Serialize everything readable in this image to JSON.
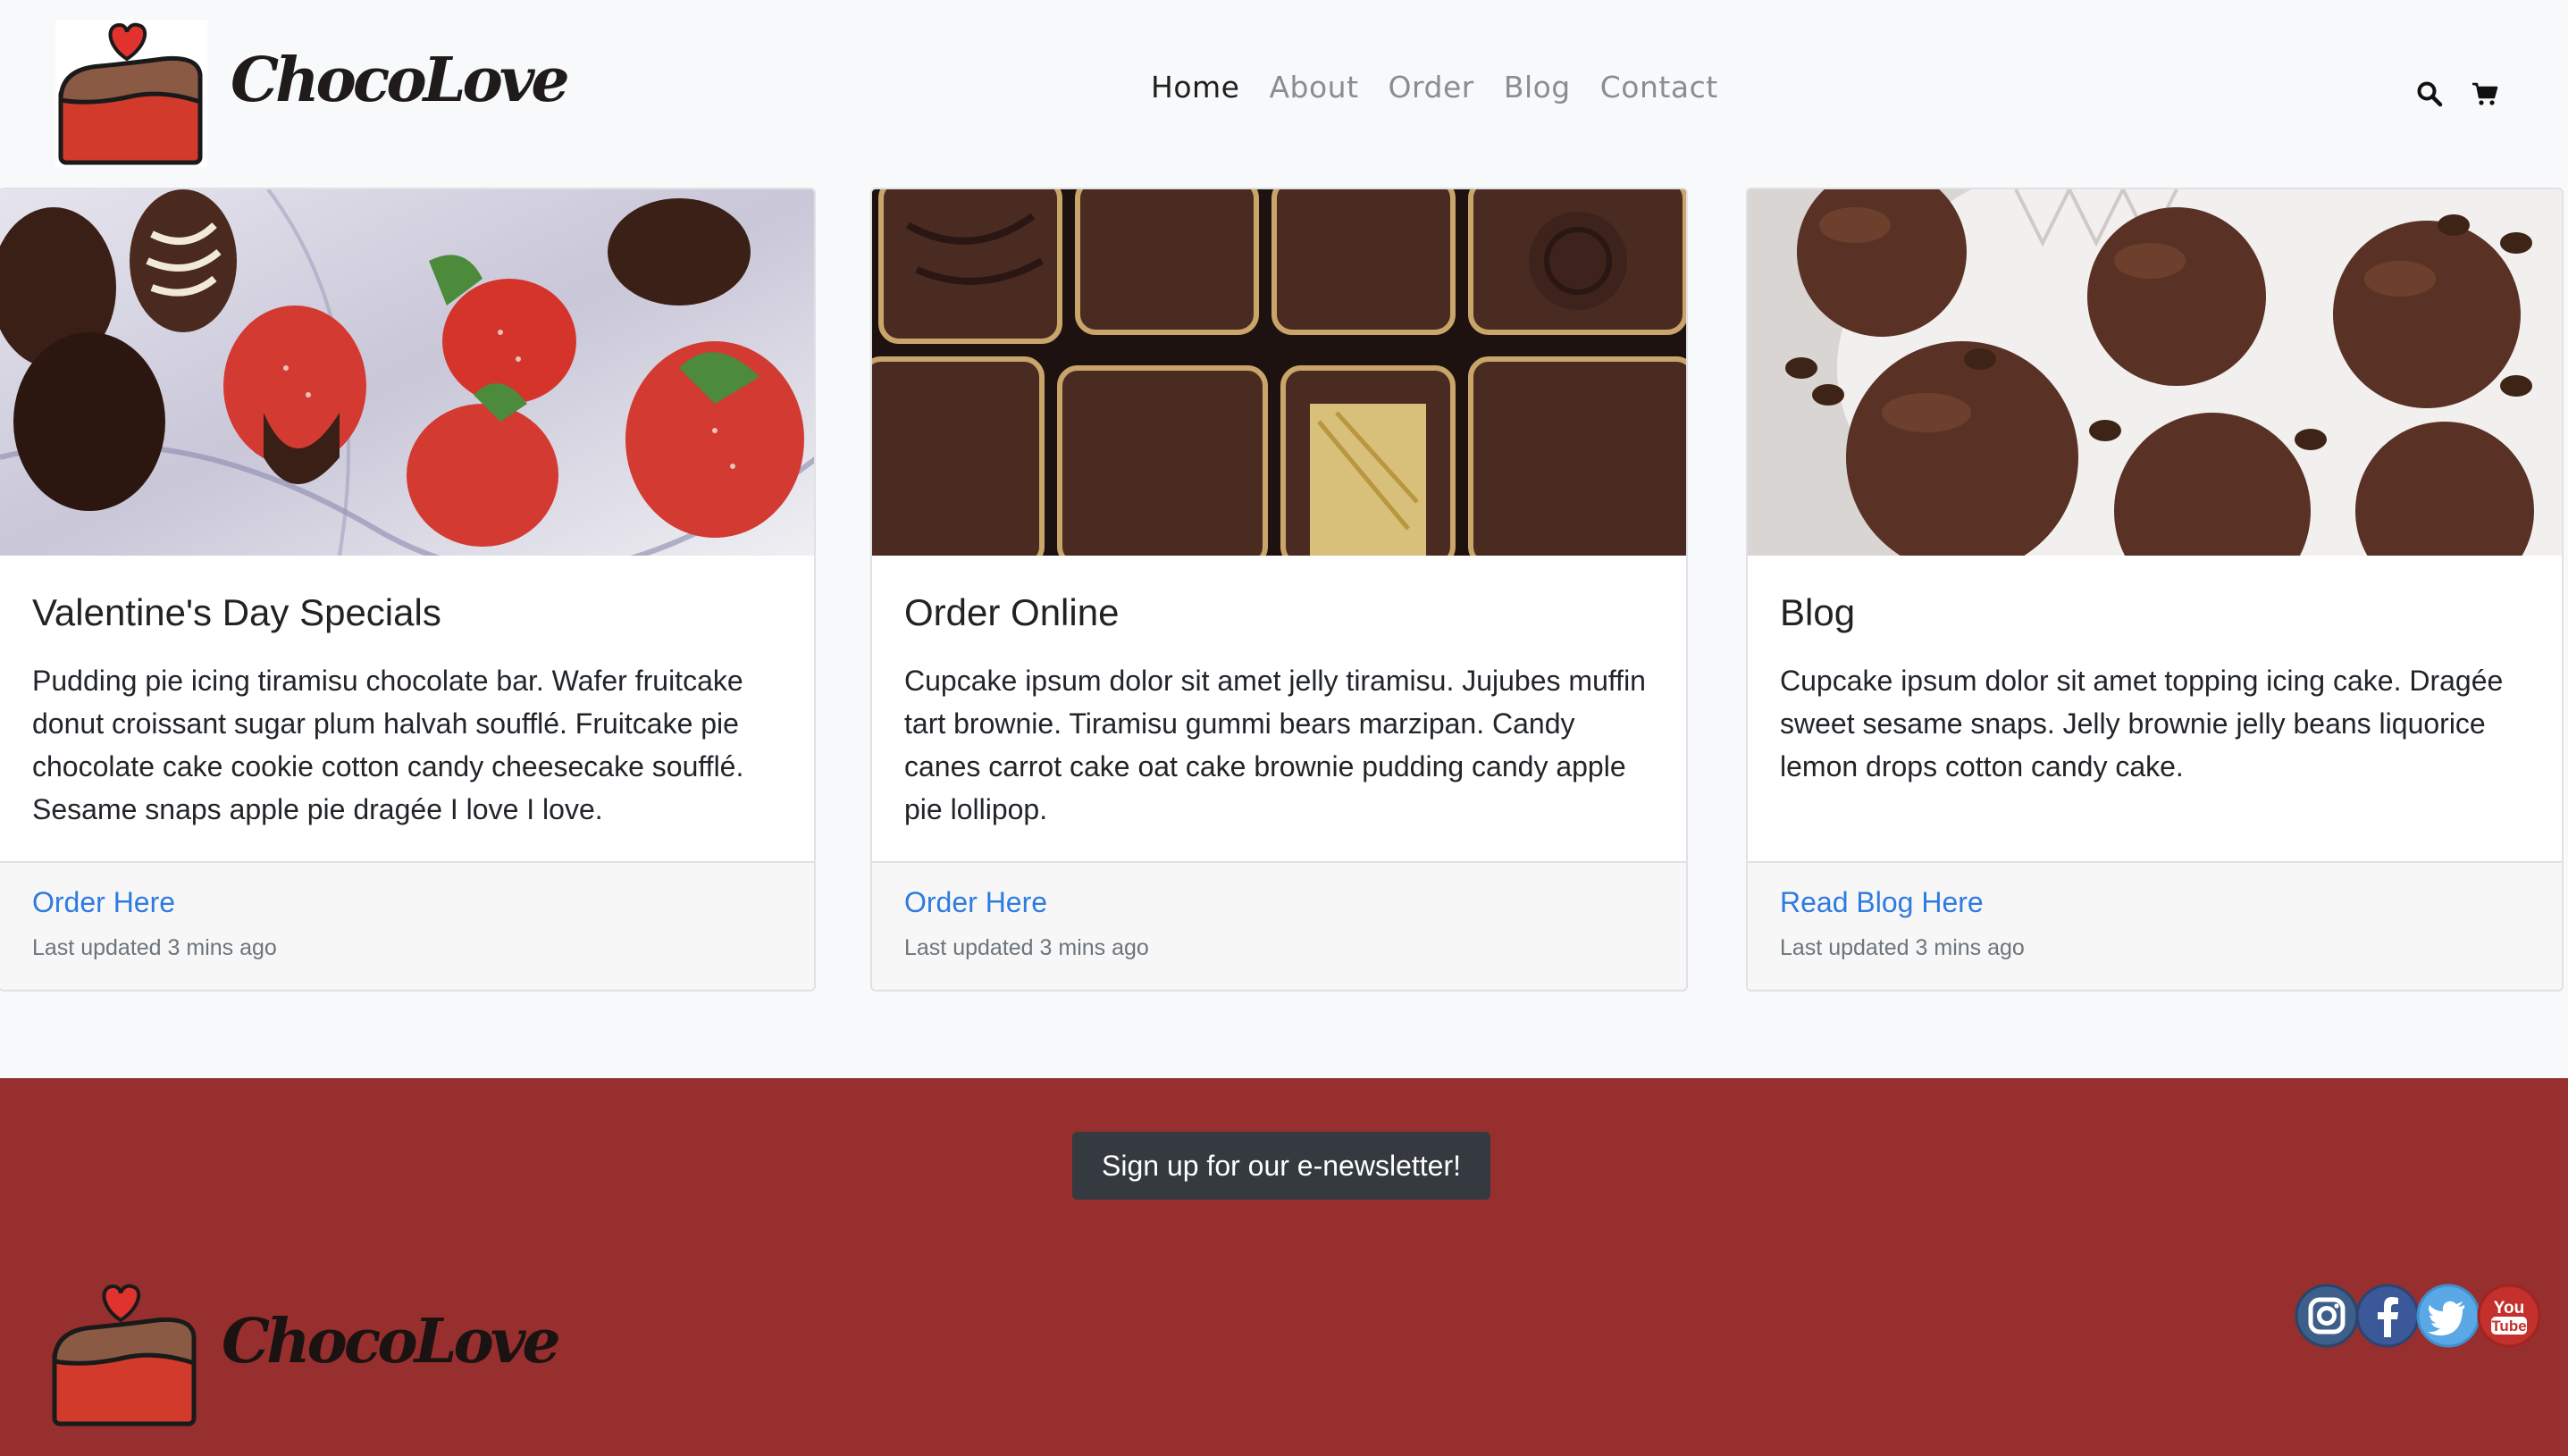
{
  "brand": {
    "name": "ChocoLove"
  },
  "nav": {
    "items": [
      {
        "label": "Home",
        "active": true
      },
      {
        "label": "About",
        "active": false
      },
      {
        "label": "Order",
        "active": false
      },
      {
        "label": "Blog",
        "active": false
      },
      {
        "label": "Contact",
        "active": false
      }
    ],
    "icons": [
      "search-icon",
      "cart-icon"
    ]
  },
  "cards": [
    {
      "image": "chocolate-covered-strawberries",
      "title": "Valentine's Day Specials",
      "text": "Pudding pie icing tiramisu chocolate bar. Wafer fruitcake donut croissant sugar plum halvah soufflé. Fruitcake pie chocolate cake cookie cotton candy cheesecake soufflé. Sesame snaps apple pie dragée I love I love.",
      "link": "Order Here",
      "updated": "Last updated 3 mins ago"
    },
    {
      "image": "box-of-chocolates",
      "title": "Order Online",
      "text": "Cupcake ipsum dolor sit amet jelly tiramisu. Jujubes muffin tart brownie. Tiramisu gummi bears marzipan. Candy canes carrot cake oat cake brownie pudding candy apple pie lollipop.",
      "link": "Order Here",
      "updated": "Last updated 3 mins ago"
    },
    {
      "image": "chocolate-truffles-coffee-beans",
      "title": "Blog",
      "text": "Cupcake ipsum dolor sit amet topping icing cake. Dragée sweet sesame snaps. Jelly brownie jelly beans liquorice lemon drops cotton candy cake.",
      "link": "Read Blog Here",
      "updated": "Last updated 3 mins ago"
    }
  ],
  "footer": {
    "newsletter_label": "Sign up for our e-newsletter!",
    "brand": "ChocoLove",
    "social": [
      "instagram-icon",
      "facebook-icon",
      "twitter-icon",
      "youtube-icon"
    ],
    "youtube_text": [
      "You",
      "Tube"
    ]
  },
  "colors": {
    "footer_bg": "#962f2e",
    "link": "#2f7be0",
    "button_bg": "#343a40",
    "cake_red": "#d23a2b",
    "heart_red": "#e0332e"
  }
}
